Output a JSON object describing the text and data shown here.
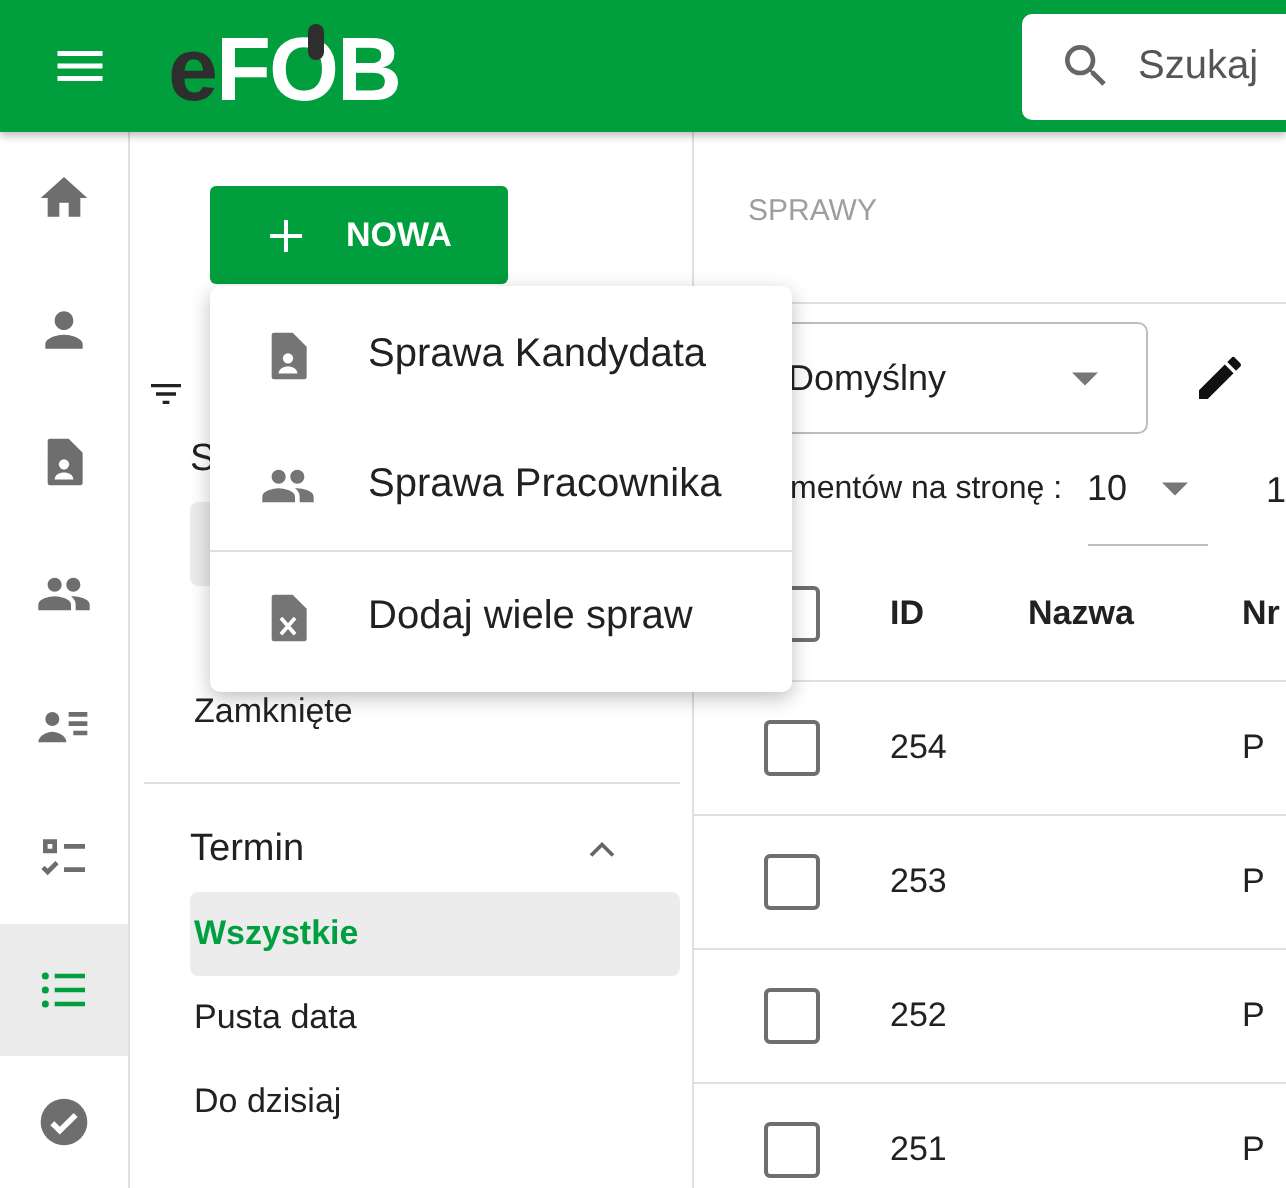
{
  "header": {
    "logo": {
      "prefix": "e",
      "name": "FOB"
    },
    "search": {
      "placeholder": "Szukaj"
    }
  },
  "rail": [
    {
      "kind": "home",
      "selected": false
    },
    {
      "kind": "person",
      "selected": false
    },
    {
      "kind": "person-doc",
      "selected": false
    },
    {
      "kind": "group",
      "selected": false
    },
    {
      "kind": "contacts",
      "selected": false
    },
    {
      "kind": "checklist",
      "selected": false
    },
    {
      "kind": "list",
      "selected": true
    },
    {
      "kind": "check-circle",
      "selected": false
    }
  ],
  "new_button": {
    "label": "NOWA"
  },
  "new_menu": [
    {
      "kind": "person-doc",
      "label": "Sprawa Kandydata"
    },
    {
      "kind": "group",
      "label": "Sprawa Pracownika"
    },
    {
      "kind": "excel",
      "label": "Dodaj wiele spraw"
    }
  ],
  "filter_panel": {
    "groups": [
      {
        "heading": "S",
        "items": [
          {
            "selected": true
          },
          {
            "label": "Zamknięte",
            "selected": false
          }
        ]
      },
      {
        "heading": "Termin",
        "expanded": true,
        "items": [
          {
            "label": "Wszystkie",
            "selected": true
          },
          {
            "label": "Pusta data",
            "selected": false
          },
          {
            "label": "Do dzisiaj",
            "selected": false
          }
        ]
      }
    ]
  },
  "main": {
    "breadcrumb": "SPRAWY",
    "view_select": {
      "value": "Domyślny"
    },
    "page_size": {
      "label": "mentów na stronę :",
      "value": "10"
    },
    "range": "1",
    "table": {
      "select_all_checked": false,
      "columns": [
        "ID",
        "Nazwa",
        "Nr"
      ],
      "rows": [
        {
          "id": "254",
          "column_3": "P",
          "checked": false
        },
        {
          "id": "253",
          "column_3": "P",
          "checked": false
        },
        {
          "id": "252",
          "column_3": "P",
          "checked": false
        },
        {
          "id": "251",
          "column_3": "P",
          "checked": false
        }
      ]
    }
  }
}
